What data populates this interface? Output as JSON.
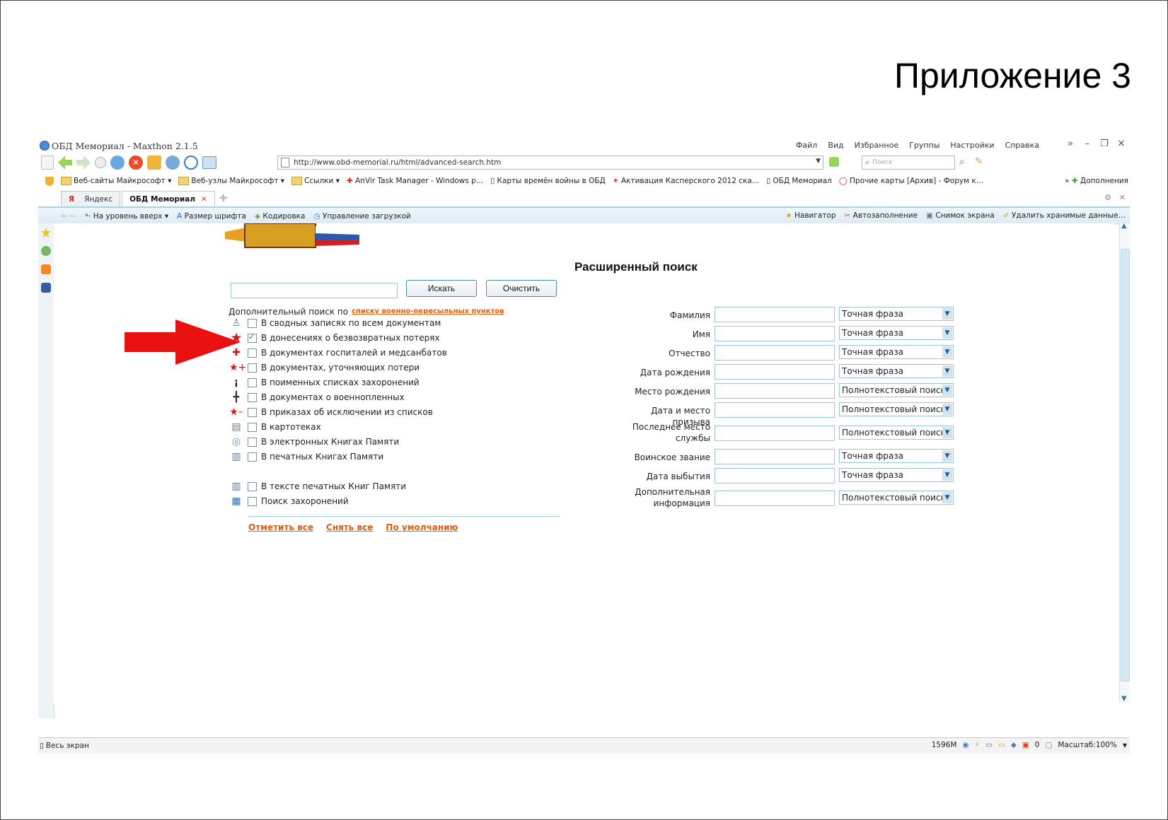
{
  "slide": {
    "title": "Приложение 3"
  },
  "window": {
    "title": "ОБД Мемориал - Maxthon 2.1.5",
    "menu": [
      "Файл",
      "Вид",
      "Избранное",
      "Группы",
      "Настройки",
      "Справка"
    ]
  },
  "address": {
    "url": "http://www.obd-memorial.ru/html/advanced-search.htm"
  },
  "search": {
    "placeholder": "Поиск"
  },
  "bookmarks": [
    "Веб-сайты Майкрософт ▾",
    "Веб-узлы Майкрософт ▾",
    "Ссылки ▾",
    "AnVir Task Manager - Windows p…",
    "Карты времён войны в ОБД",
    "Активация Касперского 2012 ска…",
    "ОБД Мемориал",
    "Прочие карты [Архив] - Форум к…"
  ],
  "bookmarks_extra": "Дополнения",
  "tabs": [
    {
      "label": "Яндекс"
    },
    {
      "label": "ОБД Мемориал"
    }
  ],
  "toolbar2": {
    "left": [
      "На уровень вверх ▾",
      "Размер шрифта",
      "Кодировка",
      "Управление загрузкой"
    ],
    "right": [
      "Навигатор",
      "Автозаполнение",
      "Снимок экрана",
      "Удалить хранимые данные…"
    ]
  },
  "page": {
    "heading": "Расширенный поиск",
    "search_button": "Искать",
    "clear_button": "Очистить",
    "extra_label": "Дополнительный поиск по",
    "extra_link": "списку военно-пересыльных пунктов",
    "checkboxes": [
      {
        "label": "В сводных записях по всем документам",
        "checked": false,
        "icon": "soldier-icon"
      },
      {
        "label": "В донесениях о безвозвратных потерях",
        "checked": true,
        "icon": "red-star-icon"
      },
      {
        "label": "В документах госпиталей и медсанбатов",
        "checked": false,
        "icon": "red-cross-icon"
      },
      {
        "label": "В документах, уточняющих потери",
        "checked": false,
        "icon": "star-plus-icon"
      },
      {
        "label": "В поименных списках захоронений",
        "checked": false,
        "icon": "obelisk-icon"
      },
      {
        "label": "В документах о военнопленных",
        "checked": false,
        "icon": "barbed-wire-icon"
      },
      {
        "label": "В приказах об исключении из списков",
        "checked": false,
        "icon": "star-minus-icon"
      },
      {
        "label": "В картотеках",
        "checked": false,
        "icon": "card-index-icon"
      },
      {
        "label": "В электронных Книгах Памяти",
        "checked": false,
        "icon": "e-book-icon"
      },
      {
        "label": "В печатных Книгах Памяти",
        "checked": false,
        "icon": "printed-book-icon"
      },
      {
        "label": "В тексте печатных Книг Памяти",
        "checked": false,
        "icon": "book-text-icon"
      },
      {
        "label": "Поиск захоронений",
        "checked": false,
        "icon": "burial-icon"
      }
    ],
    "bottom_links": [
      "Отметить все",
      "Снять все",
      "По умолчанию"
    ],
    "fields": [
      {
        "label": "Фамилия",
        "mode": "Точная фраза"
      },
      {
        "label": "Имя",
        "mode": "Точная фраза"
      },
      {
        "label": "Отчество",
        "mode": "Точная фраза"
      },
      {
        "label": "Дата рождения",
        "mode": "Точная фраза"
      },
      {
        "label": "Место рождения",
        "mode": "Полнотекстовый поиск"
      },
      {
        "label": "Дата и место призыва",
        "mode": "Полнотекстовый поиск"
      },
      {
        "label": "Последнее место службы",
        "mode": "Полнотекстовый поиск"
      },
      {
        "label": "Воинское звание",
        "mode": "Точная фраза"
      },
      {
        "label": "Дата выбытия",
        "mode": "Точная фраза"
      },
      {
        "label": "Дополнительная информация",
        "mode": "Полнотекстовый поиск"
      }
    ]
  },
  "status": {
    "left": "Весь экран",
    "memory": "1596M",
    "counter": "0",
    "zoom": "Масштаб:100%"
  },
  "colors": {
    "arrow": "#e81010",
    "link": "#e25d0c",
    "accent": "#9bc5d9"
  }
}
